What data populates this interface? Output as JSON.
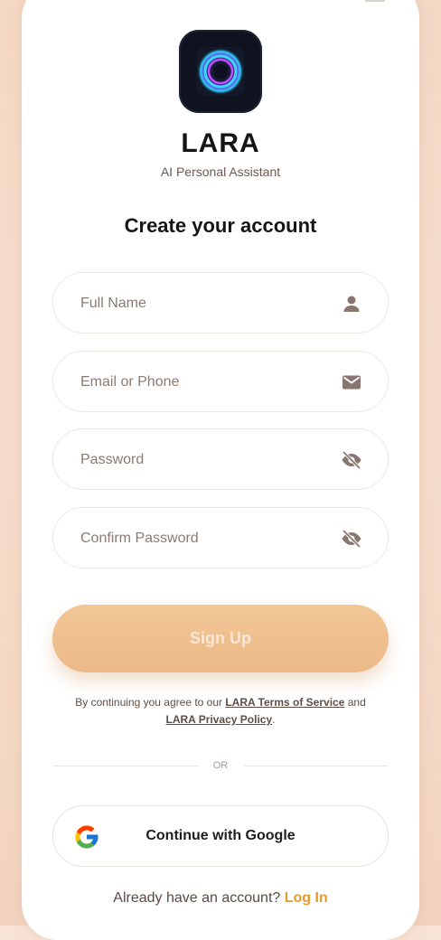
{
  "app": {
    "name": "LARA",
    "tagline": "AI Personal Assistant"
  },
  "form": {
    "heading": "Create your account",
    "fields": [
      {
        "placeholder": "Full Name",
        "icon": "person-icon"
      },
      {
        "placeholder": "Email or Phone",
        "icon": "mail-icon"
      },
      {
        "placeholder": "Password",
        "icon": "eye-off-icon"
      },
      {
        "placeholder": "Confirm Password",
        "icon": "eye-off-icon"
      }
    ],
    "submit_label": "Sign Up"
  },
  "terms": {
    "prefix": "By continuing you agree to our ",
    "tos_link": "LARA Terms of Service",
    "and": " and ",
    "privacy_link": "LARA Privacy Policy",
    "suffix": "."
  },
  "divider_label": "OR",
  "google_button": {
    "label": "Continue with Google",
    "icon": "google-icon"
  },
  "footer": {
    "prompt": "Already have an account?",
    "link": "Log In"
  },
  "colors": {
    "accent": "#e69a2b",
    "button": "#efbf8d",
    "background": "#f8e4d6"
  }
}
